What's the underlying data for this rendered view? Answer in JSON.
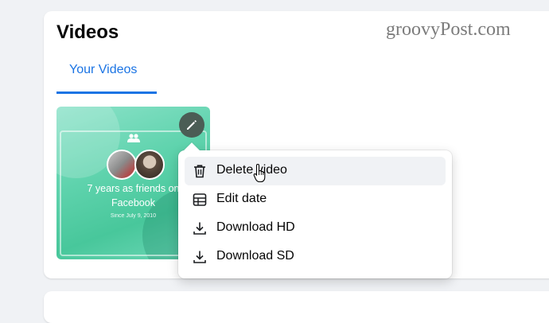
{
  "header": {
    "title": "Videos"
  },
  "watermark": "groovyPost.com",
  "tabs": [
    {
      "label": "Your Videos",
      "active": true
    }
  ],
  "video": {
    "caption_line1": "7 years as friends on",
    "caption_line2": "Facebook",
    "caption_date": "Since July 9, 2010",
    "edit_icon": "pencil-icon"
  },
  "menu": {
    "items": [
      {
        "label": "Delete video",
        "icon": "trash-icon",
        "hovered": true
      },
      {
        "label": "Edit date",
        "icon": "calendar-grid-icon"
      },
      {
        "label": "Download HD",
        "icon": "download-icon"
      },
      {
        "label": "Download SD",
        "icon": "download-icon"
      }
    ]
  },
  "colors": {
    "accent": "#1b74e4",
    "background": "#f0f2f5",
    "hover": "#f0f2f5",
    "edit_button": "#4b5d55"
  }
}
